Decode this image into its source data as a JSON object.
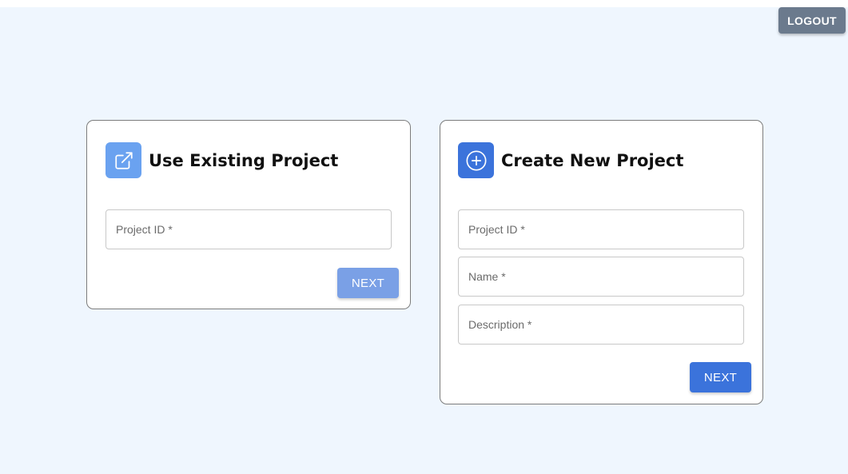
{
  "header": {
    "logout_label": "LOGOUT"
  },
  "existing_project": {
    "title": "Use Existing Project",
    "icon": "external-link-icon",
    "fields": {
      "project_id_label": "Project ID *"
    },
    "next_label": "NEXT"
  },
  "new_project": {
    "title": "Create New Project",
    "icon": "plus-circle-icon",
    "fields": {
      "project_id_label": "Project ID *",
      "name_label": "Name *",
      "description_label": "Description *"
    },
    "next_label": "NEXT"
  },
  "colors": {
    "background": "#eff6fe",
    "primary": "#3b73db",
    "primary_light": "#6aa2f0",
    "disabled_button": "#7aa0e6",
    "logout_button": "#6b7a8d"
  }
}
